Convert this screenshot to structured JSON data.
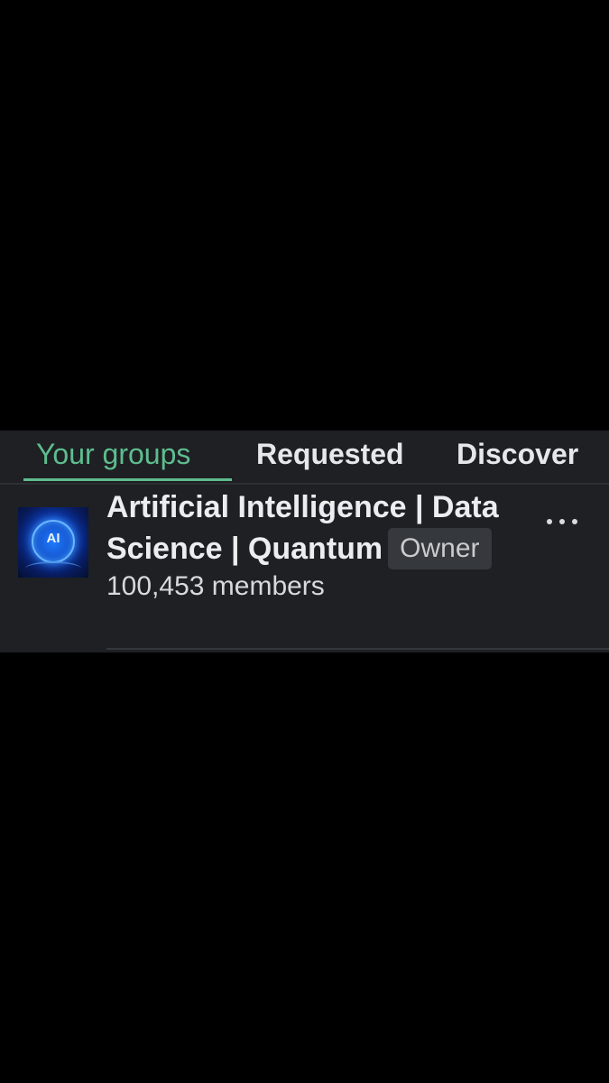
{
  "tabs": [
    {
      "label": "Your groups",
      "active": true
    },
    {
      "label": "Requested",
      "active": false
    },
    {
      "label": "Discover",
      "active": false
    }
  ],
  "groups": [
    {
      "name": "Artificial Intelligence | Data Science | Quantum",
      "role_badge": "Owner",
      "members": "100,453 members",
      "avatar_text": "AI",
      "avatar_icon": "ai-brain-globe-image",
      "more_icon": "more-horizontal-icon"
    }
  ],
  "colors": {
    "background": "#000000",
    "panel": "#1e2023",
    "accent": "#5ebd8f",
    "text_primary": "#ecedee",
    "badge_bg": "#35383c"
  }
}
